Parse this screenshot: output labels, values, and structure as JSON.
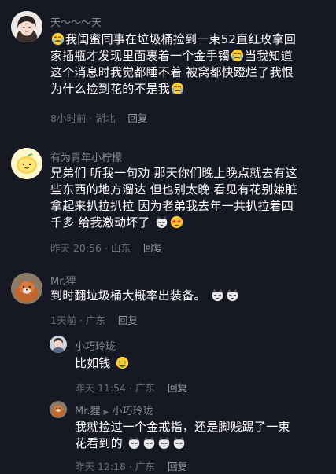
{
  "comments": [
    {
      "username": "天～～～天",
      "line1": "我闺蜜同事在垃圾桶捡到一束52直红玫拿回",
      "line2a": "家插瓶才发现里面裹着一个金手镯",
      "line2b": "当我知道",
      "line3": "这个消息时我觉都睡不着 被窝都快蹬烂了我恨",
      "line4": "为什么捡到花的不是我",
      "time": "8小时前",
      "location": "湖北",
      "reply_label": "回复"
    },
    {
      "username": "有为青年小柠檬",
      "line1": "兄弟们 听我一句劝 那天你们晚上晚点就去有这",
      "line2": "些东西的地方溜达 但也别太晚 看见有花别嫌脏",
      "line3": "拿起来扒拉扒拉 因为老弟我去年一共扒拉着四",
      "line4": "千多 给我激动坏了",
      "time": "昨天 20:56",
      "location": "山东",
      "reply_label": "回复"
    },
    {
      "username": "Mr.狸",
      "line1": "到时翻垃圾桶大概率出装备。",
      "time": "1天前",
      "location": "广东",
      "reply_label": "回复"
    },
    {
      "username": "小巧玲珑",
      "line1": "比如钱",
      "time": "昨天 11:54",
      "location": "广东",
      "reply_label": "回复"
    },
    {
      "username": "Mr.狸",
      "reply_to": "小巧玲珑",
      "line1": "我就捡过一个金戒指，还是脚贱踢了一束",
      "line2": "花看到的",
      "time": "昨天 12:18",
      "location": "广东",
      "reply_label": "回复"
    }
  ],
  "meta_separator": " · ",
  "colors": {
    "background": "#161823",
    "text": "#ffffff",
    "muted": "#8a8b91"
  }
}
